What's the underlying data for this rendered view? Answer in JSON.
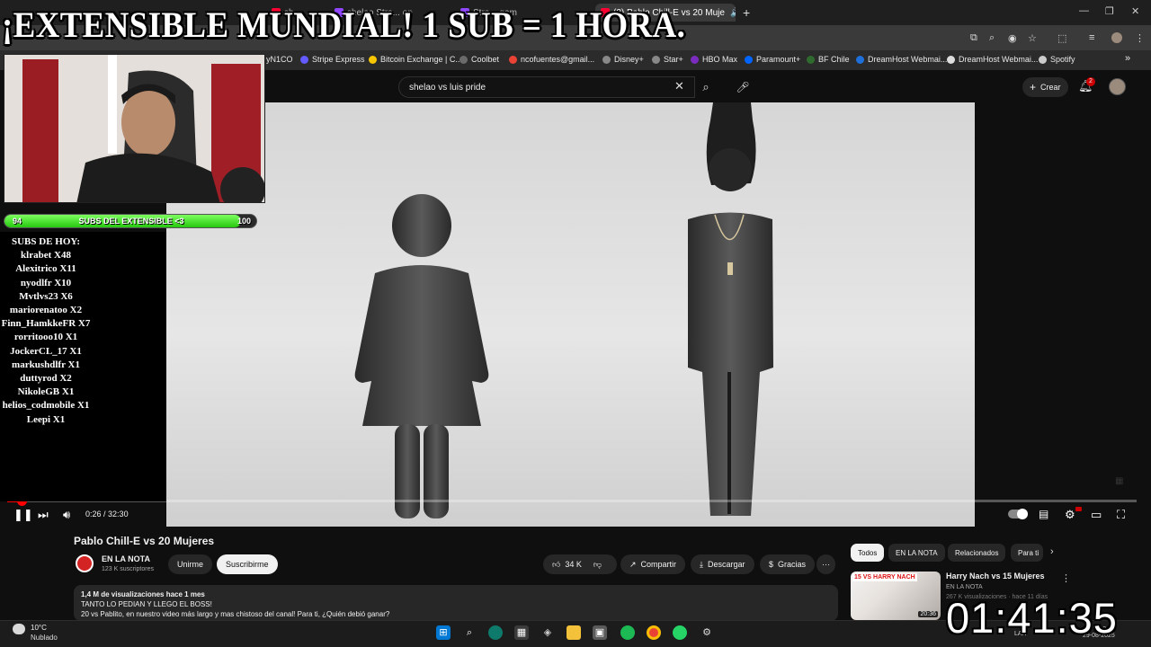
{
  "browser": {
    "tabs": [
      {
        "label": "sh...",
        "active": false
      },
      {
        "label": "shelao Stre... on",
        "active": false
      },
      {
        "label": "Stre... gam",
        "active": false
      },
      {
        "label": "(2) Pablo Chill-E vs 20 Muje",
        "active": true
      }
    ],
    "new_tab": "+",
    "bookmarks": [
      "yN1CO",
      "Stripe Express",
      "Bitcoin Exchange | C...",
      "Coolbet",
      "ncofuentes@gmail...",
      "Disney+",
      "Star+",
      "HBO Max",
      "Paramount+",
      "BF Chile",
      "DreamHost Webmai...",
      "DreamHost Webmai...",
      "Spotify"
    ],
    "bookmarks_more": "»",
    "window_controls": [
      "—",
      "❐",
      "✕"
    ]
  },
  "youtube": {
    "search_query": "shelao vs luis pride",
    "create_label": "Crear",
    "notifications_count": "2"
  },
  "player": {
    "time_current": "0:26",
    "time_total": "32:30",
    "progress_fraction": 0.013
  },
  "video": {
    "title": "Pablo Chill-E vs 20 Mujeres",
    "channel_name": "EN LA NOTA",
    "channel_subs": "123 K suscriptores",
    "join_label": "Unirme",
    "subscribe_label": "Suscribirme",
    "likes": "34 K",
    "share_label": "Compartir",
    "download_label": "Descargar",
    "thanks_label": "Gracias",
    "more_label": "···",
    "desc_stats": "1,4 M de visualizaciones  hace 1 mes",
    "desc_line1": "TANTO LO PEDIAN Y LLEGO EL BOSS!",
    "desc_line2": "20 vs Pablito, en nuestro video más largo y mas chistoso del canal! Para ti, ¿Quién debió ganar?"
  },
  "sidebar": {
    "chips": [
      {
        "label": "Todos",
        "active": true
      },
      {
        "label": "EN LA NOTA",
        "active": false
      },
      {
        "label": "Relacionados",
        "active": false
      },
      {
        "label": "Para ti",
        "active": false
      }
    ],
    "rec": {
      "title": "Harry Nach vs 15 Mujeres",
      "channel": "EN LA NOTA",
      "meta": "267 K visualizaciones · hace 11 días",
      "thumb_tag": "15 VS HARRY NACH",
      "duration": "20:36"
    }
  },
  "overlay": {
    "title": "¡EXTENSIBLE MUNDIAL! 1 SUB = 1 HORA.",
    "subbar_label": "SUBS DEL EXTENSIBLE <3",
    "subbar_start": "94",
    "subbar_end": "100",
    "subbar_fraction": 0.94,
    "subs_header": "SUBS DE HOY:",
    "subs": [
      "klrabet X48",
      "Alexitrico X11",
      "nyodlfr X10",
      "Mvtlvs23 X6",
      "mariorenatoo X2",
      "Finn_HamkkeFR X7",
      "rorritooo10 X1",
      "JockerCL_17 X1",
      "markushdlfr X1",
      "duttyrod X2",
      "NikoleGB X1",
      "helios_codmobile X1",
      "Leepi X1"
    ],
    "timer": "01:41:35"
  },
  "taskbar": {
    "temp": "10°C",
    "condition": "Nublado",
    "tray_lang": "LAA",
    "clock_time": "2:01",
    "clock_date": "29-08-2025"
  },
  "colors": {
    "accent": "#ff0000",
    "subbar_green": "#26c80f",
    "page_bg": "#0f0f0f"
  }
}
